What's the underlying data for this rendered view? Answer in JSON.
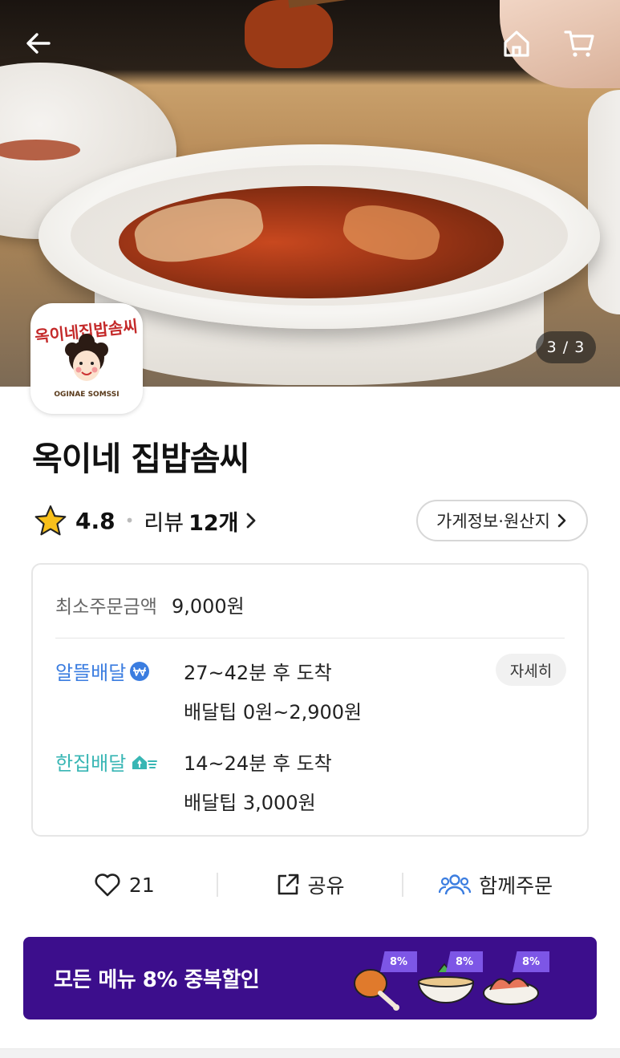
{
  "hero": {
    "page_indicator": "3 / 3",
    "logo_text": "옥이네집밥솜씨",
    "logo_subtext": "OGINAE SOMSSI"
  },
  "store": {
    "name": "옥이네 집밥솜씨",
    "rating": "4.8",
    "review_label": "리뷰",
    "review_count": "12개",
    "info_button": "가게정보·원산지"
  },
  "order_info": {
    "min_order_label": "최소주문금액",
    "min_order_value": "9,000원",
    "delivery_options": [
      {
        "name": "알뜰배달",
        "time": "27~42분 후 도착",
        "tip": "배달팁 0원~2,900원",
        "detail_button": "자세히"
      },
      {
        "name": "한집배달",
        "time": "14~24분 후 도착",
        "tip": "배달팁 3,000원"
      }
    ]
  },
  "actions": {
    "like_count": "21",
    "share_label": "공유",
    "group_order_label": "함께주문"
  },
  "banner": {
    "text": "모든 메뉴 8% 중복할인",
    "badges": [
      "8%",
      "8%",
      "8%"
    ]
  },
  "colors": {
    "banner_bg": "#3c0e8c",
    "badge": "#7d56e6",
    "saver_delivery": "#3b7de0",
    "single_delivery": "#38b6b4"
  }
}
